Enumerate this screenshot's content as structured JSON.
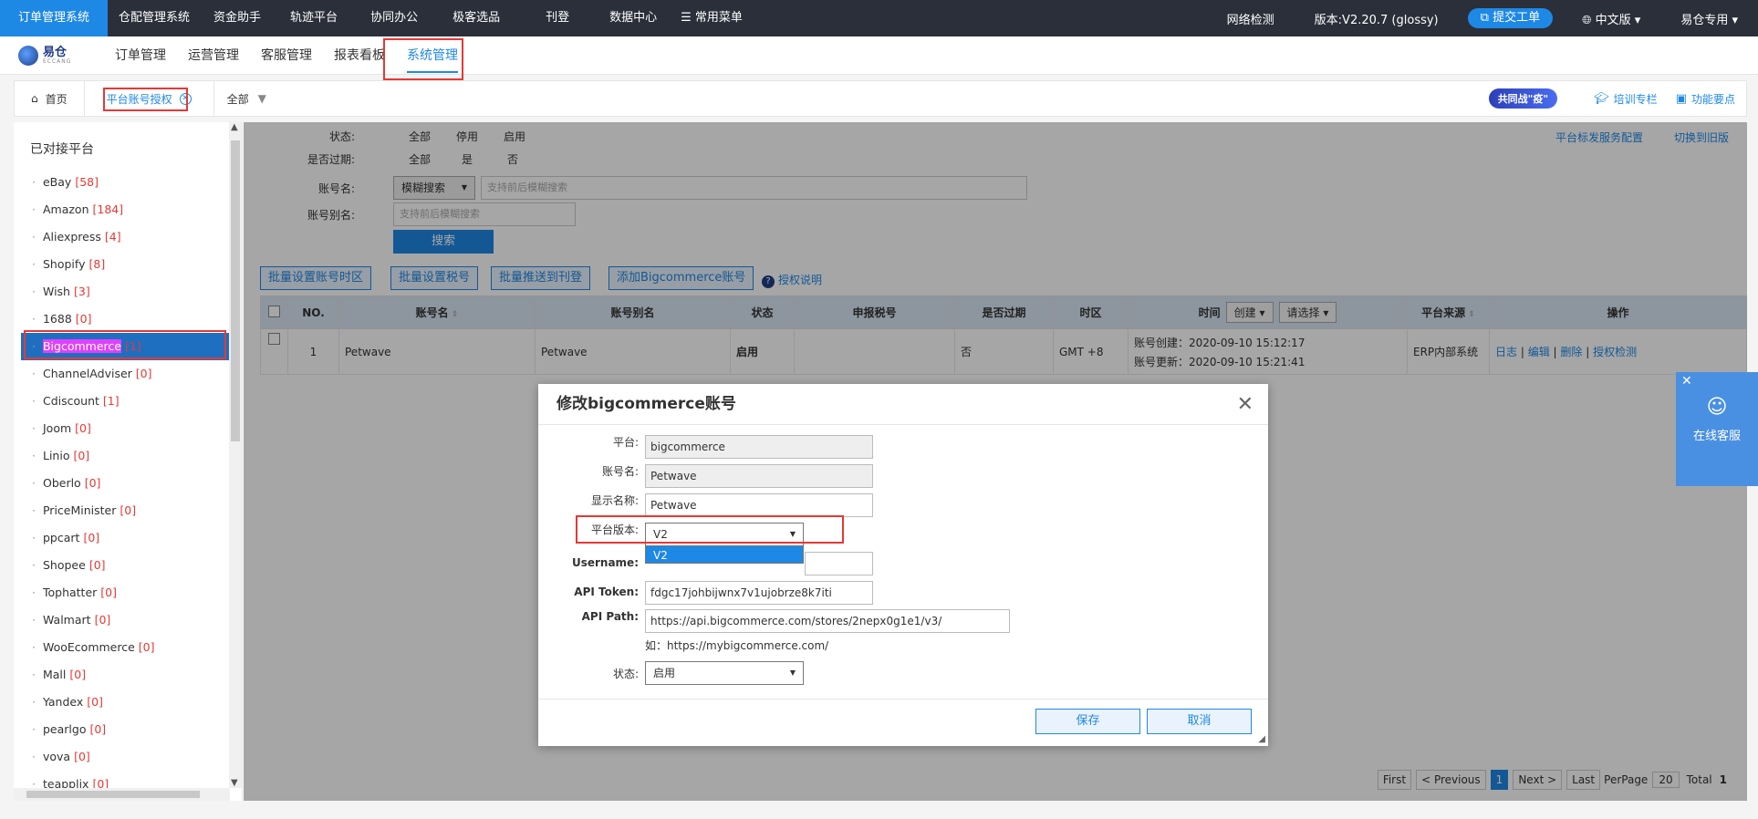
{
  "topbar": {
    "nav": [
      "订单管理系统",
      "仓配管理系统",
      "资金助手",
      "轨迹平台",
      "协同办公",
      "极客选品",
      "刊登",
      "数据中心",
      "常用菜单"
    ],
    "network": "网络检测",
    "version": "版本:V2.20.7 (glossy)",
    "ticket": "提交工单",
    "language": "中文版",
    "user": "易仓专用"
  },
  "logo": {
    "name": "易仓",
    "sub": "ECCANG"
  },
  "menu": [
    "订单管理",
    "运营管理",
    "客服管理",
    "报表看板",
    "系统管理"
  ],
  "tabs": {
    "home": "首页",
    "current": "平台账号授权",
    "filter": "全部"
  },
  "tabright": {
    "badge": "共同战\"疫\"",
    "training": "培训专栏",
    "tips": "功能要点"
  },
  "sidebar": {
    "title": "已对接平台",
    "items": [
      {
        "name": "eBay",
        "count": "[58]"
      },
      {
        "name": "Amazon",
        "count": "[184]"
      },
      {
        "name": "Aliexpress",
        "count": "[4]"
      },
      {
        "name": "Shopify",
        "count": "[8]"
      },
      {
        "name": "Wish",
        "count": "[3]"
      },
      {
        "name": "1688",
        "count": "[0]"
      },
      {
        "name": "Bigcommerce",
        "count": "[1]"
      },
      {
        "name": "ChannelAdviser",
        "count": "[0]"
      },
      {
        "name": "Cdiscount",
        "count": "[1]"
      },
      {
        "name": "Joom",
        "count": "[0]"
      },
      {
        "name": "Linio",
        "count": "[0]"
      },
      {
        "name": "Oberlo",
        "count": "[0]"
      },
      {
        "name": "PriceMinister",
        "count": "[0]"
      },
      {
        "name": "ppcart",
        "count": "[0]"
      },
      {
        "name": "Shopee",
        "count": "[0]"
      },
      {
        "name": "Tophatter",
        "count": "[0]"
      },
      {
        "name": "Walmart",
        "count": "[0]"
      },
      {
        "name": "WooEcommerce",
        "count": "[0]"
      },
      {
        "name": "Mall",
        "count": "[0]"
      },
      {
        "name": "Yandex",
        "count": "[0]"
      },
      {
        "name": "pearlgo",
        "count": "[0]"
      },
      {
        "name": "vova",
        "count": "[0]"
      },
      {
        "name": "teapplix",
        "count": "[0]"
      }
    ]
  },
  "filters": {
    "status_label": "状态:",
    "status_opts": [
      "全部",
      "停用",
      "启用"
    ],
    "expired_label": "是否过期:",
    "expired_opts": [
      "全部",
      "是",
      "否"
    ],
    "account_label": "账号名:",
    "fuzzy": "模糊搜索",
    "account_placeholder": "支持前后模糊搜索",
    "alias_label": "账号别名:",
    "alias_placeholder": "支持前后模糊搜索",
    "search": "搜索"
  },
  "toplinks": [
    "平台标发服务配置",
    "切换到旧版"
  ],
  "actions": [
    "批量设置账号时区",
    "批量设置税号",
    "批量推送到刊登",
    "添加Bigcommerce账号"
  ],
  "help": "授权说明",
  "table": {
    "headers": [
      "NO.",
      "账号名",
      "账号别名",
      "状态",
      "申报税号",
      "是否过期",
      "时区",
      "时间",
      "平台来源",
      "操作"
    ],
    "time_sel1": "创建",
    "time_sel2": "请选择",
    "row": {
      "no": "1",
      "account": "Petwave",
      "alias": "Petwave",
      "status": "启用",
      "tax": "",
      "expired": "否",
      "tz": "GMT +8",
      "created": "账号创建：2020-09-10 15:12:17",
      "updated": "账号更新：2020-09-10 15:21:41",
      "source": "ERP内部系统",
      "ops": [
        "日志",
        "编辑",
        "删除",
        "授权检测"
      ]
    }
  },
  "pager": {
    "first": "First",
    "prev": "< Previous",
    "page": "1",
    "next": "Next >",
    "last": "Last",
    "perpage_label": "PerPage",
    "perpage": "20",
    "total_label": "Total",
    "total": "1"
  },
  "modal": {
    "title": "修改bigcommerce账号",
    "platform_label": "平台:",
    "platform": "bigcommerce",
    "account_label": "账号名:",
    "account": "Petwave",
    "display_label": "显示名称:",
    "display": "Petwave",
    "version_label": "平台版本:",
    "version": "V2",
    "version_option": "V2",
    "username_label": "Username:",
    "username": "",
    "token_label": "API Token:",
    "token": "fdgc17johbijwnx7v1ujobrze8k7iti",
    "path_label": "API Path:",
    "path": "https://api.bigcommerce.com/stores/2nepx0g1e1/v3/",
    "path_hint": "如：https://mybigcommerce.com/",
    "state_label": "状态:",
    "state": "启用",
    "save": "保存",
    "cancel": "取消"
  },
  "chat": {
    "label": "在线客服"
  }
}
